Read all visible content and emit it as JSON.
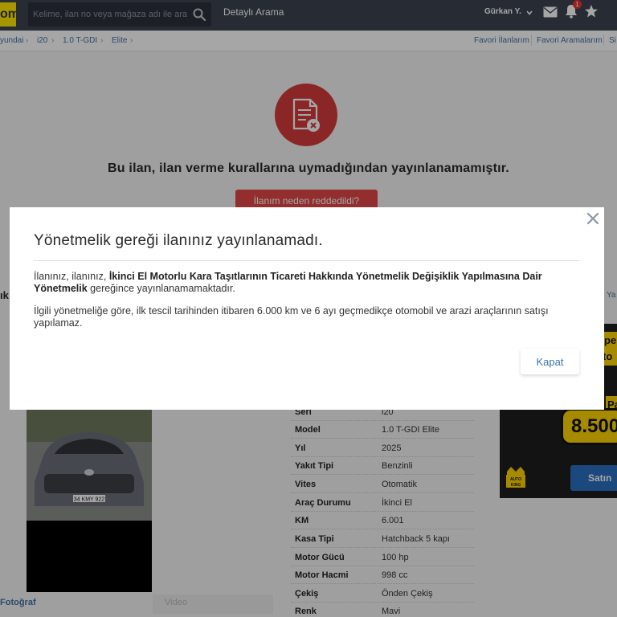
{
  "header": {
    "logo_text": "om",
    "search_placeholder": "Kelime, ilan no veya mağaza adı ile ara",
    "detailed_search": "Detaylı Arama",
    "user_name": "Gürkan Y.",
    "notification_count": "1"
  },
  "breadcrumb": {
    "items": [
      "yundai",
      "i20",
      "1.0 T-GDI",
      "Elite"
    ],
    "separator": "›",
    "right_links": [
      "Favori İlanlarım",
      "Favori Aramalarım",
      "Si"
    ]
  },
  "rejection": {
    "message": "Bu ilan, ilan verme kurallarına uymadığından yayınlanamamıştır.",
    "button": "İlanım neden reddedildi?"
  },
  "listing": {
    "side_title_fragment": "ık",
    "side_link_fragment": "Ya",
    "photo_plate": "34 KMY 922",
    "photo_tab": "Fotoğraf",
    "video_tab": "Video",
    "specs": [
      {
        "label": "Seri",
        "value": "i20"
      },
      {
        "label": "Model",
        "value": "1.0 T-GDI Elite"
      },
      {
        "label": "Yıl",
        "value": "2025"
      },
      {
        "label": "Yakıt Tipi",
        "value": "Benzinli"
      },
      {
        "label": "Vites",
        "value": "Otomatik"
      },
      {
        "label": "Araç Durumu",
        "value": "İkinci El"
      },
      {
        "label": "KM",
        "value": "6.001"
      },
      {
        "label": "Kasa Tipi",
        "value": "Hatchback 5 kapı"
      },
      {
        "label": "Motor Gücü",
        "value": "100 hp"
      },
      {
        "label": "Motor Hacmi",
        "value": "998 cc"
      },
      {
        "label": "Çekiş",
        "value": "Önden Çekiş"
      },
      {
        "label": "Renk",
        "value": "Mavi"
      }
    ]
  },
  "ad": {
    "line1": "pe",
    "line2": "to",
    "line3": "Pa",
    "price": "8.500",
    "logo_text": "AUTO KING",
    "button": "Satın a"
  },
  "modal": {
    "title": "Yönetmelik gereği ilanınız yayınlanamadı.",
    "p1_prefix": "İlanınız, ilanınız, ",
    "p1_bold": "İkinci El Motorlu Kara Taşıtlarının Ticareti Hakkında Yönetmelik Değişiklik Yapılmasına Dair Yönetmelik",
    "p1_suffix": " gereğince yayınlanamamaktadır.",
    "p2": "İlgili yönetmeliğe göre, ilk tescil tarihinden itibaren 6.000 km ve 6 ayı geçmedikçe otomobil ve arazi araçlarının satışı yapılamaz.",
    "close_button": "Kapat"
  },
  "colors": {
    "navbar": "#3b4250",
    "logo": "#ffe800",
    "reject_red": "#d63b3b",
    "link_blue": "#3e72a6",
    "ad_yellow": "#ffd600"
  }
}
